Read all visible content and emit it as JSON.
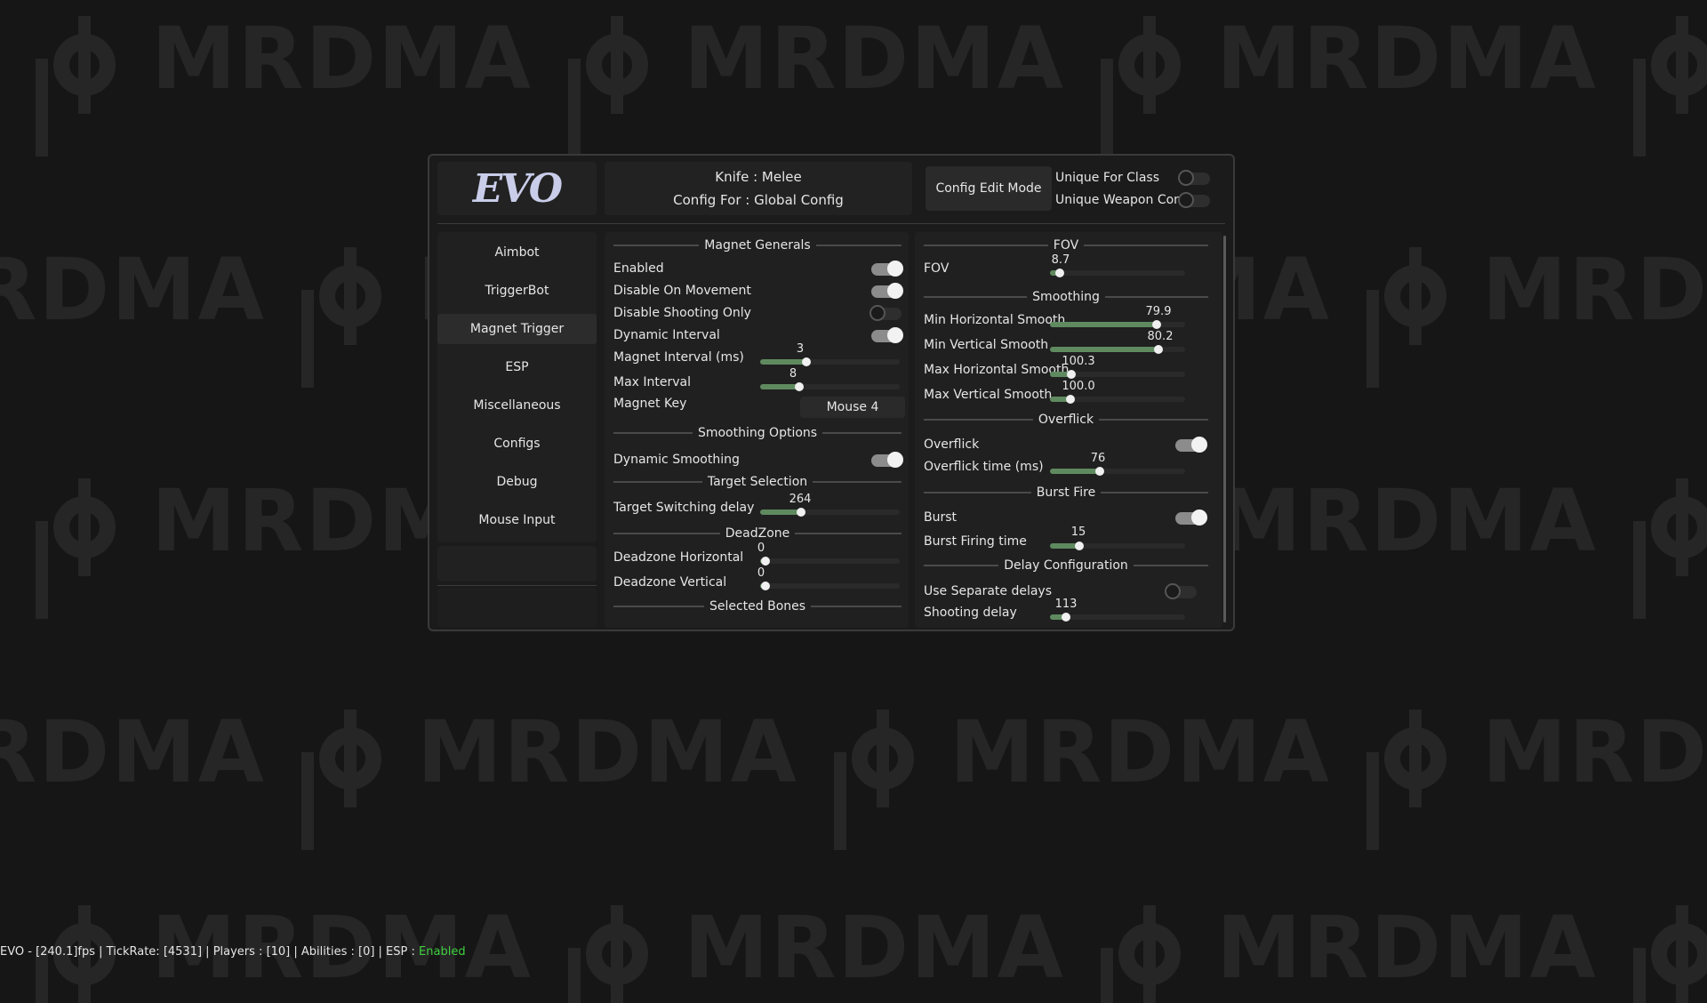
{
  "background": {
    "watermark_text": "MRDMA"
  },
  "app": {
    "logo_text": "EVO"
  },
  "header": {
    "weapon_line": "Knife : Melee",
    "config_line": "Config For : Global Config",
    "config_edit_mode_label": "Config Edit Mode",
    "unique_for_class": {
      "label": "Unique For Class",
      "on": false
    },
    "unique_weapon_config": {
      "label": "Unique Weapon Config",
      "on": false
    }
  },
  "sidebar": {
    "active": "Magnet Trigger",
    "items": [
      {
        "label": "Aimbot"
      },
      {
        "label": "TriggerBot"
      },
      {
        "label": "Magnet Trigger"
      },
      {
        "label": "ESP"
      },
      {
        "label": "Miscellaneous"
      },
      {
        "label": "Configs"
      },
      {
        "label": "Debug"
      },
      {
        "label": "Mouse Input"
      }
    ]
  },
  "middle": {
    "magnet_generals": {
      "title": "Magnet Generals",
      "enabled": {
        "label": "Enabled",
        "on": true
      },
      "disable_on_movement": {
        "label": "Disable On Movement",
        "on": true
      },
      "disable_shooting_only": {
        "label": "Disable Shooting Only",
        "on": false
      },
      "dynamic_interval": {
        "label": "Dynamic Interval",
        "on": true
      },
      "magnet_interval": {
        "label": "Magnet Interval (ms)",
        "value": "3",
        "fraction": 0.33
      },
      "max_interval": {
        "label": "Max Interval",
        "value": "8",
        "fraction": 0.28
      },
      "magnet_key": {
        "label": "Magnet Key",
        "value": "Mouse 4"
      }
    },
    "smoothing_options": {
      "title": "Smoothing Options",
      "dynamic_smoothing": {
        "label": "Dynamic Smoothing",
        "on": true
      }
    },
    "target_selection": {
      "title": "Target Selection",
      "target_switching_delay": {
        "label": "Target Switching delay",
        "value": "264",
        "fraction": 0.29
      }
    },
    "deadzone": {
      "title": "DeadZone",
      "horizontal": {
        "label": "Deadzone Horizontal",
        "value": "0",
        "fraction": 0.04
      },
      "vertical": {
        "label": "Deadzone Vertical",
        "value": "0",
        "fraction": 0.04
      }
    },
    "selected_bones": {
      "title": "Selected Bones"
    }
  },
  "right": {
    "fov": {
      "title": "FOV",
      "fov": {
        "label": "FOV",
        "value": "8.7",
        "fraction": 0.07
      }
    },
    "smoothing": {
      "title": "Smoothing",
      "min_horizontal": {
        "label": "Min Horizontal Smooth",
        "value": "79.9",
        "fraction": 0.79
      },
      "min_vertical": {
        "label": "Min Vertical Smooth",
        "value": "80.2",
        "fraction": 0.8
      },
      "max_horizontal": {
        "label": "Max Horizontal Smooth",
        "value": "100.3",
        "fraction": 0.16
      },
      "max_vertical": {
        "label": "Max Vertical Smooth",
        "value": "100.0",
        "fraction": 0.15
      }
    },
    "overflick": {
      "title": "Overflick",
      "overflick": {
        "label": "Overflick",
        "on": true
      },
      "overflick_time": {
        "label": "Overflick time (ms)",
        "value": "76",
        "fraction": 0.37
      }
    },
    "burst_fire": {
      "title": "Burst Fire",
      "burst": {
        "label": "Burst",
        "on": true
      },
      "burst_firing_time": {
        "label": "Burst Firing time",
        "value": "15",
        "fraction": 0.22
      }
    },
    "delay_configuration": {
      "title": "Delay Configuration",
      "use_separate_delays": {
        "label": "Use Separate delays",
        "on": false
      },
      "shooting_delay": {
        "label": "Shooting delay",
        "value": "113",
        "fraction": 0.12
      }
    }
  },
  "status_bar": {
    "prefix": "EVO - [240.1]fps | TickRate: [4531] | Players : [10] | Abilities : [0] | ESP :",
    "esp_state": "Enabled"
  },
  "colors": {
    "accent_slider": "#5f8a5f",
    "status_enabled": "#3fd13f",
    "logo": "#c9cde9"
  }
}
